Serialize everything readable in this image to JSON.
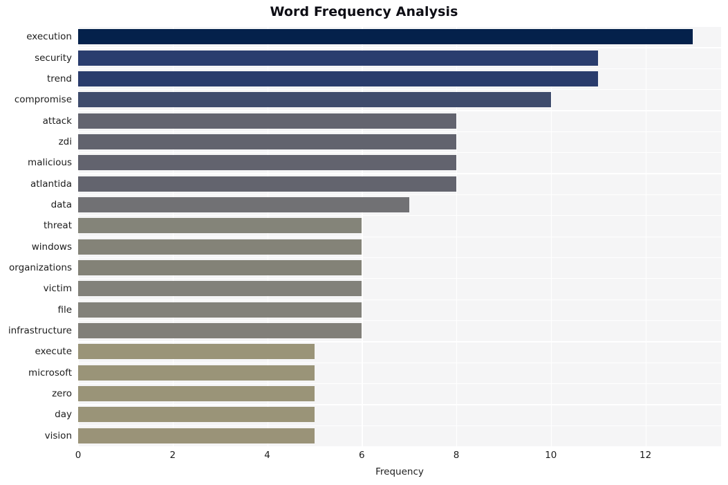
{
  "chart_data": {
    "type": "bar",
    "orientation": "horizontal",
    "title": "Word Frequency Analysis",
    "xlabel": "Frequency",
    "ylabel": "",
    "xlim": [
      0,
      13.6
    ],
    "ylim": [
      0,
      20
    ],
    "grid": true,
    "legend": null,
    "xticks": [
      0,
      2,
      4,
      6,
      8,
      10,
      12
    ],
    "xtick_labels": [
      "0",
      "2",
      "4",
      "6",
      "8",
      "10",
      "12"
    ],
    "categories": [
      "execution",
      "security",
      "trend",
      "compromise",
      "attack",
      "zdi",
      "malicious",
      "atlantida",
      "data",
      "threat",
      "windows",
      "organizations",
      "victim",
      "file",
      "infrastructure",
      "execute",
      "microsoft",
      "zero",
      "day",
      "vision"
    ],
    "values": [
      13,
      11,
      11,
      10,
      8,
      8,
      8,
      8,
      7,
      6,
      6,
      6,
      6,
      6,
      6,
      5,
      5,
      5,
      5,
      5
    ],
    "bar_colors": [
      "#04214b",
      "#2a3d6e",
      "#2a3c6c",
      "#3e4b6c",
      "#63646f",
      "#62636e",
      "#62636e",
      "#63646e",
      "#717174",
      "#848479",
      "#848378",
      "#838277",
      "#82817a",
      "#82817a",
      "#817f79",
      "#9a9478",
      "#9a9478",
      "#9a9478",
      "#9a9478",
      "#9a9378"
    ],
    "plot_background": "#f5f5f6",
    "gridline_color": "#ffffff",
    "figure_background": "#ffffff"
  }
}
